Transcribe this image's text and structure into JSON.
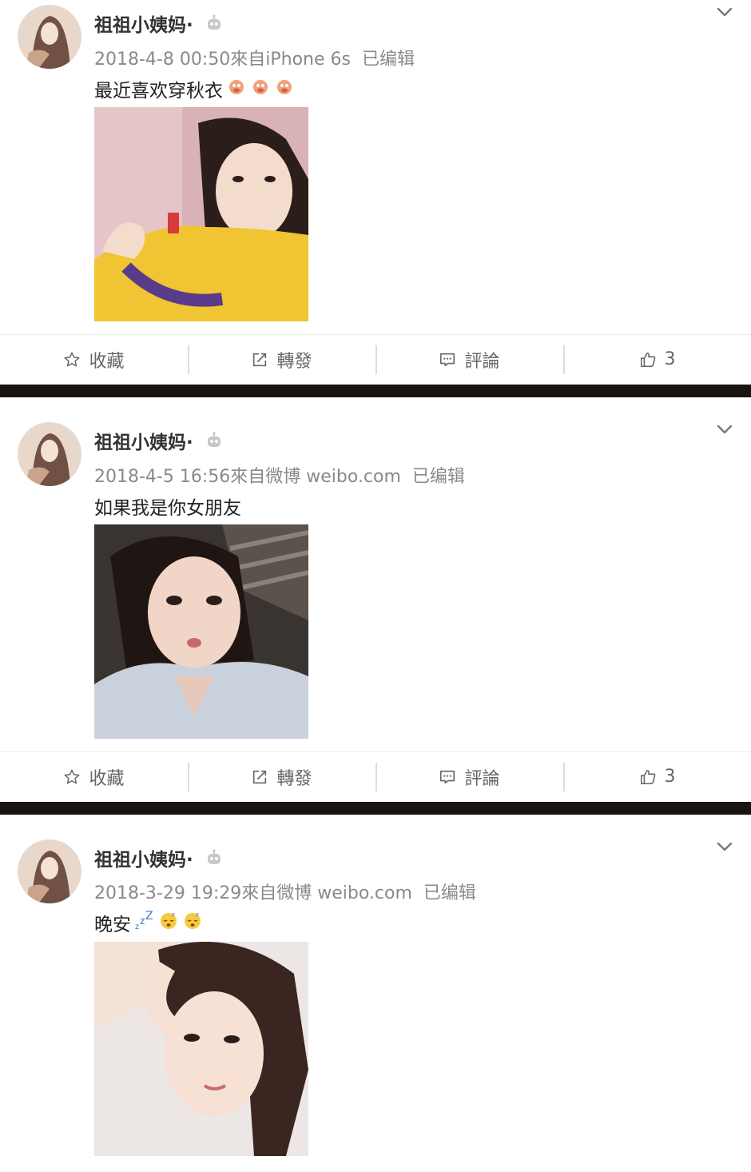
{
  "posts": [
    {
      "name": "祖祖小姨妈·",
      "time": "2018-4-8 00:50",
      "source": "來自iPhone 6s",
      "edited": "已编辑",
      "text": "最近喜欢穿秋衣"
    },
    {
      "name": "祖祖小姨妈·",
      "time": "2018-4-5 16:56",
      "source": "來自微博 weibo.com",
      "edited": "已编辑",
      "text": "如果我是你女朋友"
    },
    {
      "name": "祖祖小姨妈·",
      "time": "2018-3-29 19:29",
      "source": "來自微博 weibo.com",
      "edited": "已编辑",
      "text": "晚安"
    }
  ],
  "actions": {
    "favorite": "收藏",
    "repost": "轉發",
    "comment": "評論",
    "like_count": "3"
  },
  "icons": {
    "favorite": "star-outline-icon",
    "repost": "share-arrow-icon",
    "comment": "comment-bubble-icon",
    "like": "thumbs-up-icon",
    "more": "chevron-down-icon",
    "badge": "robot-badge-icon"
  },
  "colors": {
    "separator": "#1a1410",
    "meta_text": "#8a8a8a",
    "action_text": "#666666"
  }
}
